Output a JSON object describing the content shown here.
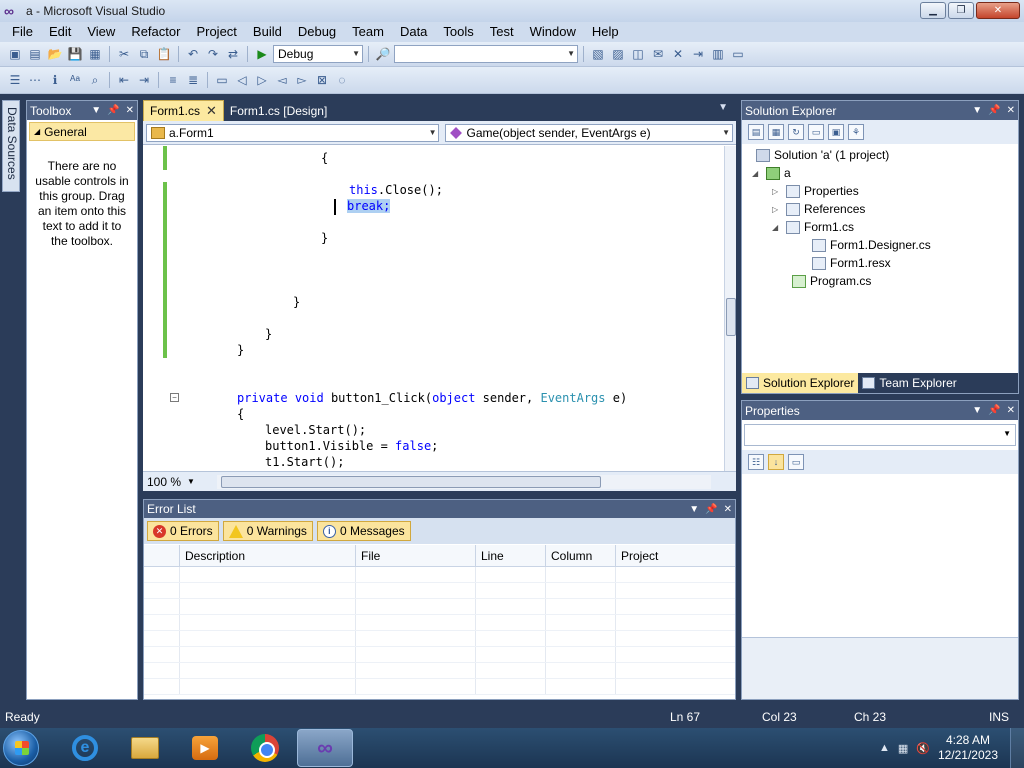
{
  "window": {
    "title": "a - Microsoft Visual Studio"
  },
  "menu": [
    "File",
    "Edit",
    "View",
    "Refactor",
    "Project",
    "Build",
    "Debug",
    "Team",
    "Data",
    "Tools",
    "Test",
    "Window",
    "Help"
  ],
  "toolbar": {
    "config": "Debug",
    "platform": ""
  },
  "side_strip": {
    "label": "Data Sources"
  },
  "toolbox": {
    "title": "Toolbox",
    "group": "General",
    "empty_message": "There are no usable controls in this group. Drag an item onto this text to add it to the toolbox."
  },
  "editor": {
    "tabs": [
      {
        "label": "Form1.cs",
        "active": true
      },
      {
        "label": "Form1.cs [Design]",
        "active": false
      }
    ],
    "class_combo": "a.Form1",
    "member_combo": "Game(object sender, EventArgs e)",
    "zoom": "100 %",
    "code": {
      "line1": "{",
      "line2_kw": "this",
      "line2_rest": ".Close();",
      "line3": "break;",
      "line4": "}",
      "line5": "}",
      "line6": "}",
      "line7": "}",
      "line8_kw1": "private",
      "line8_kw2": "void",
      "line8_name": " button1_Click(",
      "line8_kw3": "object",
      "line8_mid": " sender, ",
      "line8_type": "EventArgs",
      "line8_end": " e)",
      "line9": "{",
      "line10": "level.Start();",
      "line11_a": "button1.Visible = ",
      "line11_kw": "false",
      "line11_b": ";",
      "line12": "t1.Start();"
    }
  },
  "error_list": {
    "title": "Error List",
    "errors": "0 Errors",
    "warnings": "0 Warnings",
    "messages": "0 Messages",
    "columns": [
      "Description",
      "File",
      "Line",
      "Column",
      "Project"
    ]
  },
  "solution_explorer": {
    "title": "Solution Explorer",
    "tree": {
      "solution": "Solution 'a' (1 project)",
      "project": "a",
      "properties": "Properties",
      "references": "References",
      "form1": "Form1.cs",
      "designer": "Form1.Designer.cs",
      "resx": "Form1.resx",
      "program": "Program.cs"
    },
    "tabs": [
      "Solution Explorer",
      "Team Explorer"
    ]
  },
  "properties": {
    "title": "Properties"
  },
  "status": {
    "state": "Ready",
    "ln": "Ln 67",
    "col": "Col 23",
    "ch": "Ch 23",
    "mode": "INS"
  },
  "taskbar": {
    "time": "4:28 AM",
    "date": "12/21/2023"
  }
}
